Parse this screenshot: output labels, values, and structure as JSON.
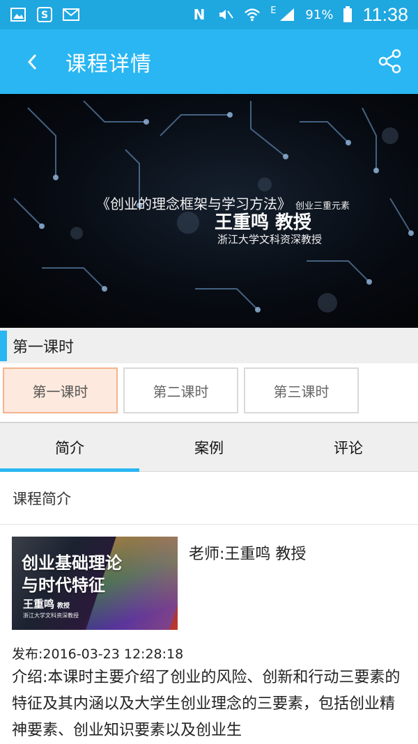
{
  "status_bar": {
    "battery_percent": "91%",
    "time": "11:38",
    "network_label": "E",
    "left_icons": [
      "gallery-icon",
      "s-notification-icon",
      "mail-icon"
    ],
    "right_icons": [
      "nfc-icon",
      "mute-icon",
      "wifi-icon",
      "signal-icon",
      "battery-icon"
    ]
  },
  "app_bar": {
    "title": "课程详情",
    "back_icon": "chevron-left-icon",
    "share_icon": "share-icon",
    "background": "#29b6f2"
  },
  "video": {
    "title": "《创业的理念框架与学习方法》",
    "subtitle": "创业三重元素",
    "lecturer": "王重鸣 教授",
    "affiliation": "浙江大学文科资深教授"
  },
  "section": {
    "title": "第一课时"
  },
  "lessons": [
    {
      "label": "第一课时",
      "active": true
    },
    {
      "label": "第二课时",
      "active": false
    },
    {
      "label": "第三课时",
      "active": false
    }
  ],
  "tabs": [
    {
      "label": "简介",
      "active": true
    },
    {
      "label": "案例",
      "active": false
    },
    {
      "label": "评论",
      "active": false
    }
  ],
  "intro": {
    "heading": "课程简介",
    "thumbnail": {
      "title_line1": "创业基础理论",
      "title_line2": "与时代特征",
      "name": "王重鸣",
      "name_suffix": "教授",
      "affiliation": "浙江大学文科资深教授"
    },
    "teacher": "老师:王重鸣 教授",
    "published": "发布:2016-03-23 12:28:18",
    "description": "介绍:本课时主要介绍了创业的风险、创新和行动三要素的特征及其内涵以及大学生创业理念的三要素，包括创业精神要素、创业知识要素以及创业生"
  },
  "colors": {
    "accent": "#29b6f2",
    "status_bar": "#1fa7e0",
    "active_lesson_bg": "#fde9dd",
    "active_lesson_border": "#f4b48e"
  }
}
